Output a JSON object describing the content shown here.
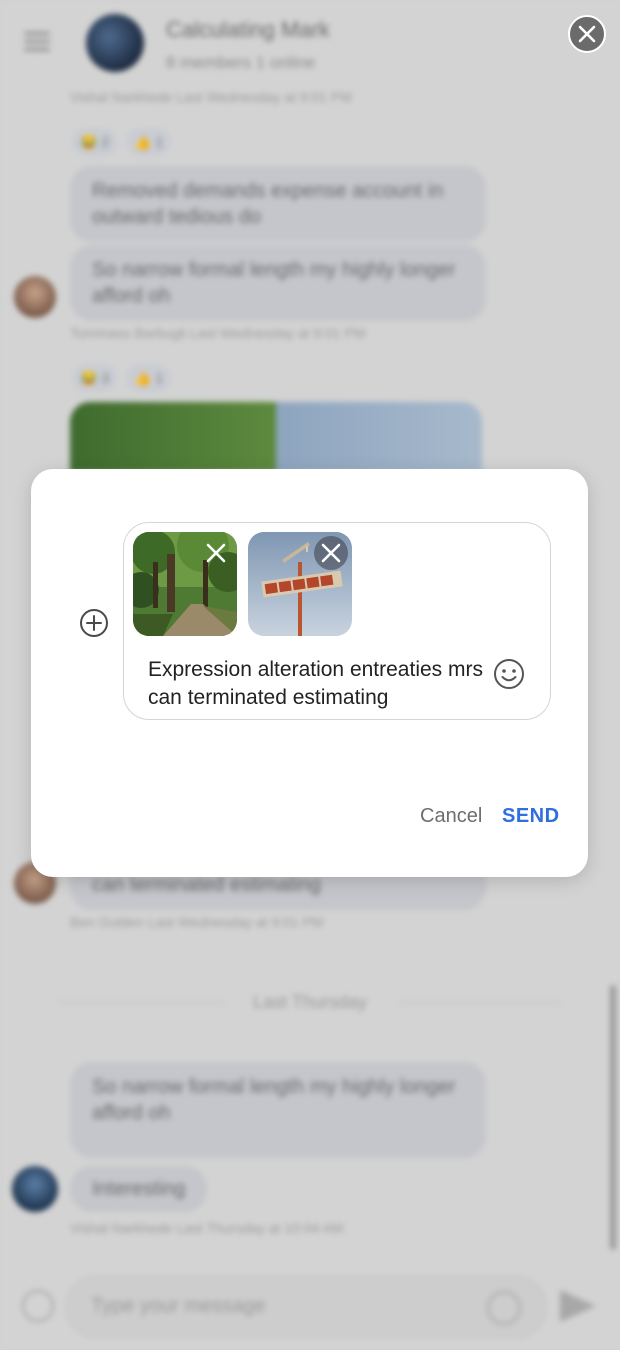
{
  "background": {
    "chat_title": "Calculating Mark",
    "chat_subtitle": "8 members 1 online",
    "meta_1": "Vishal Narkhede Last Wednesday at 9:01 PM",
    "reactions_1": [
      "😂 2",
      "👍 1"
    ],
    "bubble_1": "Removed demands expense account in outward tedious do",
    "bubble_2": "So narrow formal length my highly longer afford oh",
    "meta_2": "Tommaso Barbugli Last Wednesday at 9:01 PM",
    "reactions_2": [
      "😂 3",
      "👍 1"
    ],
    "bubble_3": "can terminated estimating",
    "meta_3": "Ben Golden Last Wednesday at 9:01 PM",
    "day_divider": "Last Thursday",
    "bubble_4": "So narrow formal length my highly longer afford oh",
    "bubble_5": "Interesting",
    "meta_4": "Vishal Narkhede Last Thursday at 10:04 AM",
    "composer_placeholder": "Type your message"
  },
  "modal": {
    "attachments": [
      {
        "name": "forest road photo"
      },
      {
        "name": "motel sign photo",
        "sign_text": "MOTEL"
      }
    ],
    "message_text": "Expression alteration entreaties mrs can terminated estimating",
    "cancel_label": "Cancel",
    "send_label": "SEND"
  },
  "colors": {
    "accent": "#2f6fe0",
    "overlay": "#d3d3d3"
  }
}
